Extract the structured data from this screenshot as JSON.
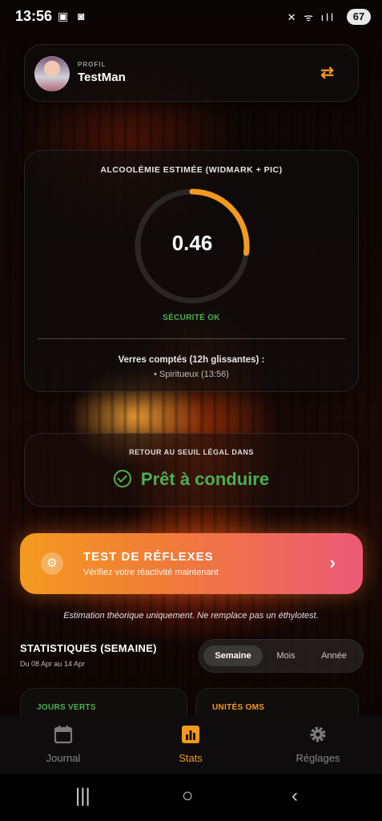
{
  "status": {
    "time": "13:56",
    "battery": "67"
  },
  "profile": {
    "label": "PROFIL",
    "name": "TestMan"
  },
  "bac": {
    "title": "ALCOOLÉMIE ESTIMÉE (WIDMARK + PIC)",
    "value": "0.46",
    "gauge_fraction": 0.27,
    "status": "SÉCURITÉ OK",
    "drinks_title": "Verres comptés (12h glissantes) :",
    "drink_item": "• Spiritueux (13:56)"
  },
  "legal": {
    "title": "RETOUR AU SEUIL LÉGAL DANS",
    "ready": "Prêt à conduire"
  },
  "reflex": {
    "title": "TEST DE RÉFLEXES",
    "subtitle": "Vérifiez votre réactivité maintenant"
  },
  "disclaimer": "Estimation théorique uniquement. Ne remplace pas un éthylotest.",
  "stats": {
    "title": "STATISTIQUES (SEMAINE)",
    "range": "Du 08 Apr au 14 Apr",
    "segments": [
      "Semaine",
      "Mois",
      "Année"
    ],
    "card_green": "JOURS VERTS",
    "card_units": "UNITÉS OMS"
  },
  "nav": {
    "items": [
      {
        "label": "Journal",
        "icon": "calendar-icon"
      },
      {
        "label": "Stats",
        "icon": "chart-icon"
      },
      {
        "label": "Réglages",
        "icon": "gear-icon"
      }
    ]
  },
  "colors": {
    "accent": "#f39a1e",
    "success": "#4caf50",
    "gradient_end": "#ec5a78"
  }
}
